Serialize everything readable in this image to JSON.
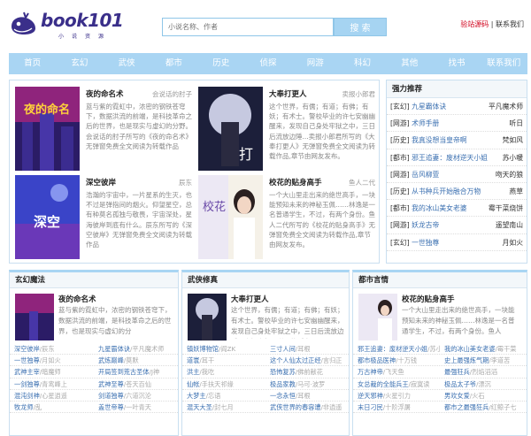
{
  "header": {
    "logo_text": "book101",
    "logo_sub": "小说资源",
    "search_placeholder": "小说名称、作者",
    "search_button": "搜 索",
    "link_bad": "验站源码",
    "link_sep": " | ",
    "link_contact": "联系我们"
  },
  "nav": [
    "首页",
    "玄幻",
    "武侠",
    "都市",
    "历史",
    "侦探",
    "网游",
    "科幻",
    "其他",
    "找书",
    "联系我们"
  ],
  "featured": [
    {
      "title": "夜的命名术",
      "author": "会说话的肘子",
      "desc": "蓝与紫的霓虹中，浓密的钢铁苍穹下，数据洪流的前端，是科技革命之后的世界，也是现实与虚幻的分野。会说话的肘子所写的《夜的命名术》无弹窗免费全文阅读为转载作品"
    },
    {
      "title": "大奉打更人",
      "author": "卖报小郎君",
      "desc": "这个世界，有儒；有道；有佛；有妖；有术士。警校毕业的许七安幽幽醒来，发现自己身处牢狱之中，三日后流放边陲...卖报小郎君所写的《大奉打更人》无弹窗免费全文阅读为转载作品,章节由网友发布。"
    },
    {
      "title": "深空彼岸",
      "author": "辰东",
      "desc": "浩瀚的宇宙中，一片星系的生灭，也不过是弹指间的烟火。仰望星空，总有种莫名孤独与敬畏，宇宙深处，星海彼岸到底有什么。辰东所写的《深空彼岸》无弹窗免费全文阅读为转载作品"
    },
    {
      "title": "校花的贴身高手",
      "author": "鱼人二代",
      "desc": "一个大山里走出来的绝世高手，一块能预知未来的神秘玉佩……林逸是一名普通学生，不过，有两个身份。鱼人二代所写的《校花的贴身高手》无弹窗免费全文阅读为转载作品,章节由网友发布。"
    }
  ],
  "hot": {
    "title": "强力推荐",
    "items": [
      {
        "cat": "[玄幻]",
        "book": "九星霸体诀",
        "author": "平凡魔术师"
      },
      {
        "cat": "[网游]",
        "book": "术师手册",
        "author": "听日"
      },
      {
        "cat": "[历史]",
        "book": "我真没想当皇帝啊",
        "author": "梵如风"
      },
      {
        "cat": "[都市]",
        "book": "邪王追妻：废材逆天小姐",
        "author": "苏小暖"
      },
      {
        "cat": "[网游]",
        "book": "岳风柳萱",
        "author": "吻天的狼"
      },
      {
        "cat": "[历史]",
        "book": "从书种兵开始融合万物",
        "author": "燕草"
      },
      {
        "cat": "[都市]",
        "book": "我的冰山美女老婆",
        "author": "霉干菜烧饼"
      },
      {
        "cat": "[网游]",
        "book": "妖龙古帝",
        "author": "遥望南山"
      },
      {
        "cat": "[玄幻]",
        "book": "一世独尊",
        "author": "月如火"
      }
    ]
  },
  "categories": [
    {
      "title": "玄幻魔法",
      "feature": {
        "title": "夜的命名术",
        "desc": "蓝与紫的霓虹中，浓密的钢铁苍穹下，数据洪流的前端，是科技革命之后的世界，也是现实与虚幻的分"
      },
      "rows": [
        [
          {
            "b": "深空彼岸",
            "a": "/辰东"
          },
          {
            "b": "九星霸体诀",
            "a": "/平凡魔术师"
          }
        ],
        [
          {
            "b": "一世独尊",
            "a": "/月如火"
          },
          {
            "b": "武炼巅峰",
            "a": "/莫默"
          }
        ],
        [
          {
            "b": "武神主宰",
            "a": "/暗魔师"
          },
          {
            "b": "开局签到荒古圣体",
            "a": "/J神"
          }
        ],
        [
          {
            "b": "一剑独尊",
            "a": "/青鸾峰上"
          },
          {
            "b": "武神至尊",
            "a": "/苍天百仙"
          }
        ],
        [
          {
            "b": "混沌剑神",
            "a": "/心星逍遥"
          },
          {
            "b": "剑道独尊",
            "a": "/六道沉沦"
          }
        ],
        [
          {
            "b": "牧龙师",
            "a": "/乱"
          },
          {
            "b": "盖世帝尊",
            "a": "/一叶青天"
          }
        ]
      ]
    },
    {
      "title": "武侠修真",
      "feature": {
        "title": "大奉打更人",
        "desc": "这个世界，有儒；有道；有佛；有妖；有术士。警校毕业的许七安幽幽醒来，发现自己身处牢狱之中，三日后流放边陲...卖报小郎君所写的《大"
      },
      "rows": [
        [
          {
            "b": "镇妖博物馆",
            "a": "/阎ZK"
          },
          {
            "b": "三寸人间",
            "a": "/耳根"
          }
        ],
        [
          {
            "b": "道寰",
            "a": "/耳干"
          },
          {
            "b": "这个人仙太过正经",
            "a": "/言归正"
          }
        ],
        [
          {
            "b": "洪主",
            "a": "/我吃"
          },
          {
            "b": "恐怖复苏",
            "a": "/佛前献花"
          }
        ],
        [
          {
            "b": "仙帐",
            "a": "/手扶天祁缘"
          },
          {
            "b": "极品家教",
            "a": "/马可·波罗"
          }
        ],
        [
          {
            "b": "大梦主",
            "a": "/忘语"
          },
          {
            "b": "一念永恒",
            "a": "/耳根"
          }
        ],
        [
          {
            "b": "混天大圣",
            "a": "/封七月"
          },
          {
            "b": "武侠世界的春容遭",
            "a": "/非逍遥"
          }
        ]
      ]
    },
    {
      "title": "都市言情",
      "feature": {
        "title": "校花的贴身高手",
        "desc": "一个大山里走出来的绝世高手，一块能预知未来的神秘玉佩……林逸是一名普通学生，不过，有两个身份。鱼人"
      },
      "rows": [
        [
          {
            "b": "邪王追妻：废材逆天小姐",
            "a": "/苏小暖"
          },
          {
            "b": "我的冰山美女老婆",
            "a": "/霉干菜"
          }
        ],
        [
          {
            "b": "都市极品医神",
            "a": "/十万钱"
          },
          {
            "b": "史上最强炼气期",
            "a": "/李道苦"
          }
        ],
        [
          {
            "b": "万古神帝",
            "a": "/飞天鱼"
          },
          {
            "b": "最强狂兵",
            "a": "/烈焰滔滔"
          }
        ],
        [
          {
            "b": "女总裁的全能兵王",
            "a": "/寂寞读"
          },
          {
            "b": "极品太子爷",
            "a": "/漂沉"
          }
        ],
        [
          {
            "b": "逆天邪神",
            "a": "/火星引力"
          },
          {
            "b": "男欢女爱",
            "a": "/火石"
          }
        ],
        [
          {
            "b": "末日刁民",
            "a": "/十阶浮屠"
          },
          {
            "b": "都市之最强狂兵",
            "a": "/红鲸子七"
          }
        ]
      ]
    }
  ],
  "colors": {
    "nav": "#a9d5f3",
    "logo": "#3a2f8a",
    "link": "#3a6fb0",
    "accent_red": "#d0021b"
  }
}
